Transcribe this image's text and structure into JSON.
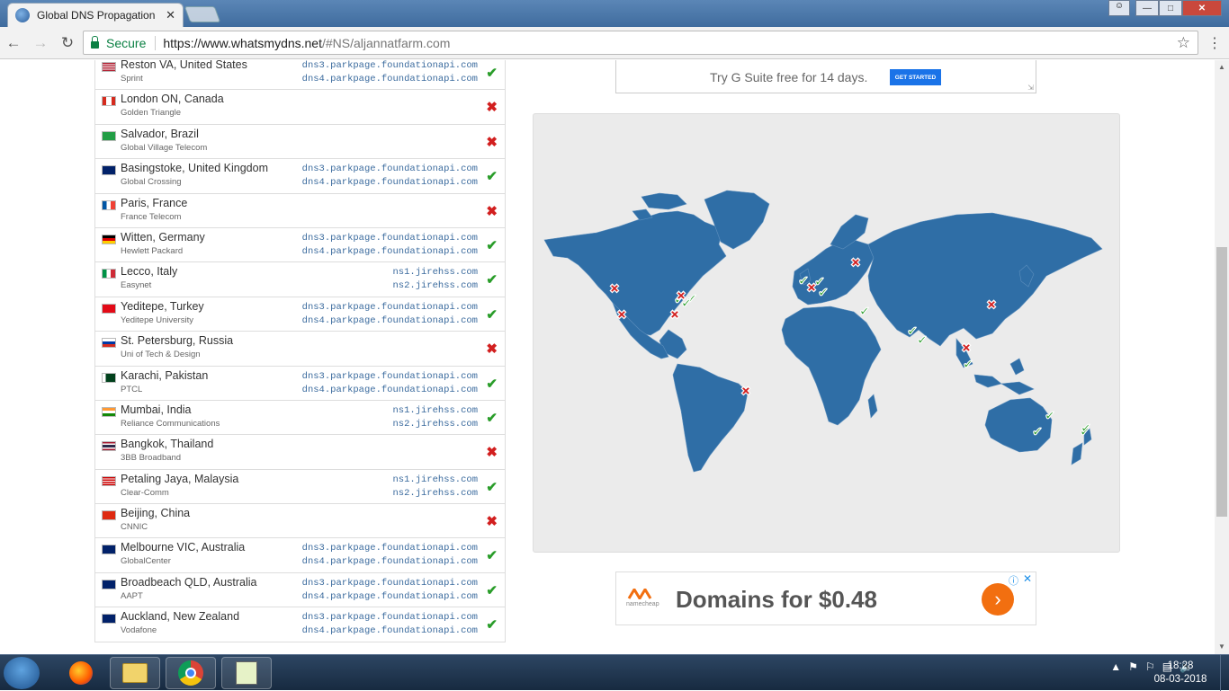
{
  "browser": {
    "tab_title": "Global DNS Propagation",
    "tab_close": "✕",
    "secure_label": "Secure",
    "url_host": "https://www.whatsmydns.net",
    "url_path": "/#NS/aljannatfarm.com"
  },
  "results": [
    {
      "location": "Reston VA, United States",
      "isp": "Sprint",
      "ns1": "dns3.parkpage.foundationapi.com",
      "ns2": "dns4.parkpage.foundationapi.com",
      "status": "ok",
      "flag": "us"
    },
    {
      "location": "London ON, Canada",
      "isp": "Golden Triangle",
      "ns1": "",
      "ns2": "",
      "status": "fail",
      "flag": "ca"
    },
    {
      "location": "Salvador, Brazil",
      "isp": "Global Village Telecom",
      "ns1": "",
      "ns2": "",
      "status": "fail",
      "flag": "br"
    },
    {
      "location": "Basingstoke, United Kingdom",
      "isp": "Global Crossing",
      "ns1": "dns3.parkpage.foundationapi.com",
      "ns2": "dns4.parkpage.foundationapi.com",
      "status": "ok",
      "flag": "uk"
    },
    {
      "location": "Paris, France",
      "isp": "France Telecom",
      "ns1": "",
      "ns2": "",
      "status": "fail",
      "flag": "fr"
    },
    {
      "location": "Witten, Germany",
      "isp": "Hewlett Packard",
      "ns1": "dns3.parkpage.foundationapi.com",
      "ns2": "dns4.parkpage.foundationapi.com",
      "status": "ok",
      "flag": "de"
    },
    {
      "location": "Lecco, Italy",
      "isp": "Easynet",
      "ns1": "ns1.jirehss.com",
      "ns2": "ns2.jirehss.com",
      "status": "ok",
      "flag": "it"
    },
    {
      "location": "Yeditepe, Turkey",
      "isp": "Yeditepe University",
      "ns1": "dns3.parkpage.foundationapi.com",
      "ns2": "dns4.parkpage.foundationapi.com",
      "status": "ok",
      "flag": "tr"
    },
    {
      "location": "St. Petersburg, Russia",
      "isp": "Uni of Tech & Design",
      "ns1": "",
      "ns2": "",
      "status": "fail",
      "flag": "ru"
    },
    {
      "location": "Karachi, Pakistan",
      "isp": "PTCL",
      "ns1": "dns3.parkpage.foundationapi.com",
      "ns2": "dns4.parkpage.foundationapi.com",
      "status": "ok",
      "flag": "pk"
    },
    {
      "location": "Mumbai, India",
      "isp": "Reliance Communications",
      "ns1": "ns1.jirehss.com",
      "ns2": "ns2.jirehss.com",
      "status": "ok",
      "flag": "in"
    },
    {
      "location": "Bangkok, Thailand",
      "isp": "3BB Broadband",
      "ns1": "",
      "ns2": "",
      "status": "fail",
      "flag": "th"
    },
    {
      "location": "Petaling Jaya, Malaysia",
      "isp": "Clear-Comm",
      "ns1": "ns1.jirehss.com",
      "ns2": "ns2.jirehss.com",
      "status": "ok",
      "flag": "my"
    },
    {
      "location": "Beijing, China",
      "isp": "CNNIC",
      "ns1": "",
      "ns2": "",
      "status": "fail",
      "flag": "cn"
    },
    {
      "location": "Melbourne VIC, Australia",
      "isp": "GlobalCenter",
      "ns1": "dns3.parkpage.foundationapi.com",
      "ns2": "dns4.parkpage.foundationapi.com",
      "status": "ok",
      "flag": "au"
    },
    {
      "location": "Broadbeach QLD, Australia",
      "isp": "AAPT",
      "ns1": "dns3.parkpage.foundationapi.com",
      "ns2": "dns4.parkpage.foundationapi.com",
      "status": "ok",
      "flag": "au"
    },
    {
      "location": "Auckland, New Zealand",
      "isp": "Vodafone",
      "ns1": "dns3.parkpage.foundationapi.com",
      "ns2": "dns4.parkpage.foundationapi.com",
      "status": "ok",
      "flag": "nz"
    }
  ],
  "status_icons": {
    "ok": "✔",
    "fail": "✖"
  },
  "ad_top": {
    "text": "Try G Suite free for 14 days.",
    "button": "GET STARTED"
  },
  "ad_bottom": {
    "brand": "namecheap",
    "headline": "Domains for $0.48",
    "arrow": "›"
  },
  "taskbar": {
    "time": "18:28",
    "date": "08-03-2018"
  },
  "colors": {
    "ok": "#2a9d2a",
    "fail": "#d21f1f",
    "map_land": "#2f6ea6",
    "map_bg": "#ebebeb"
  }
}
